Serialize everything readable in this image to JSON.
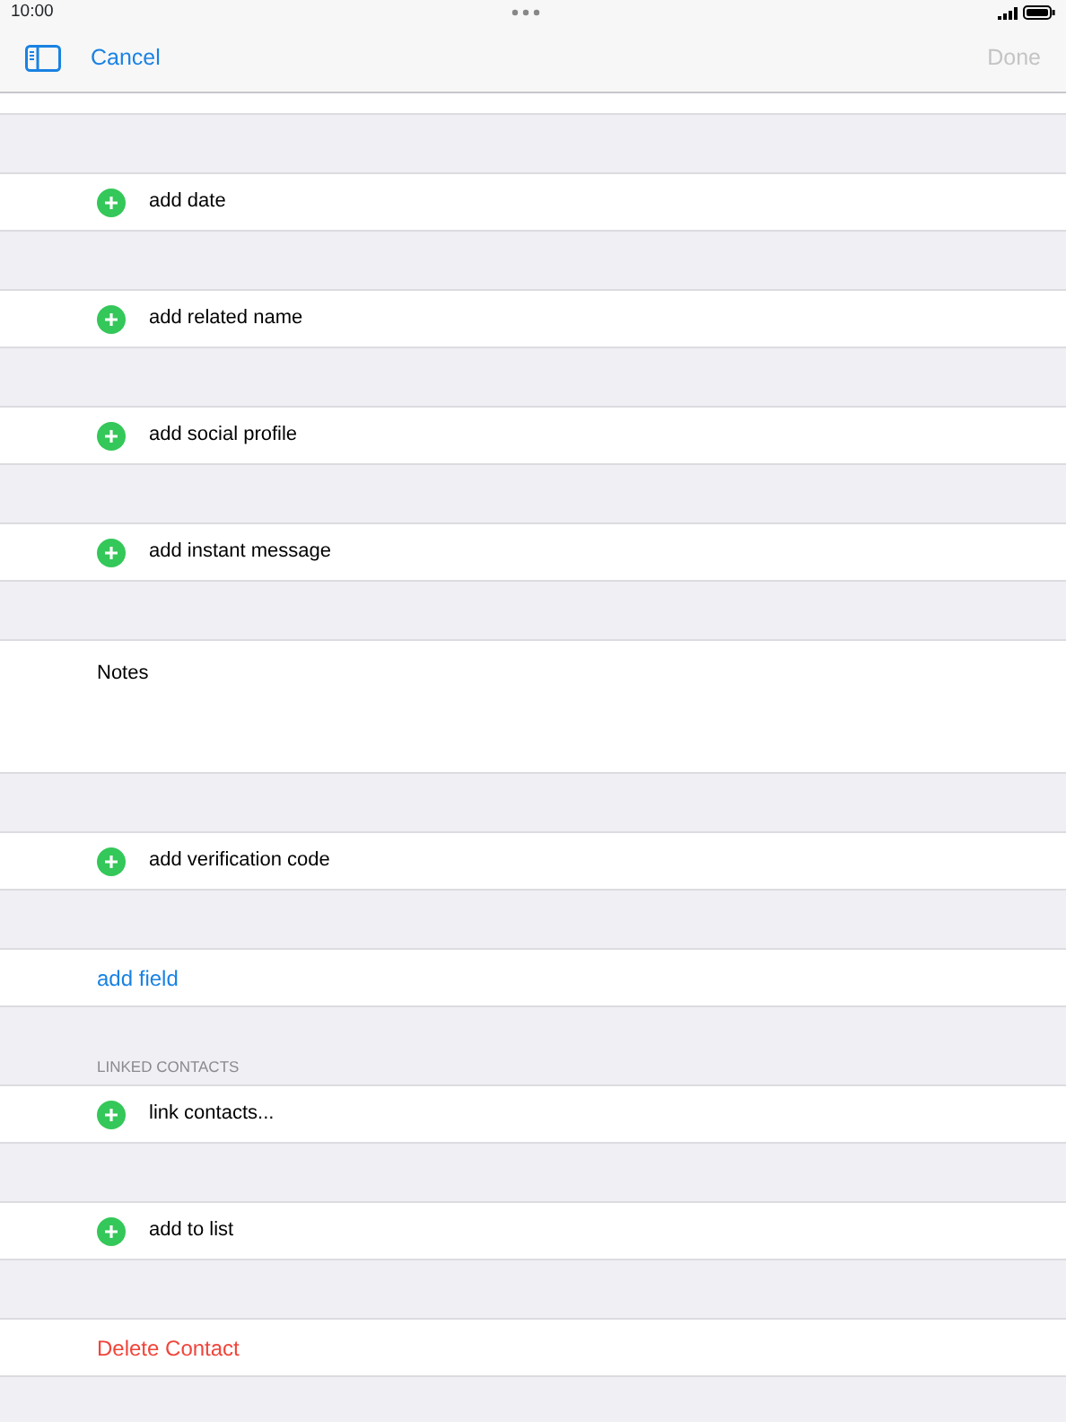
{
  "status_bar": {
    "time": "10:00"
  },
  "nav": {
    "cancel": "Cancel",
    "done": {
      "label": "Done",
      "disabled": true
    }
  },
  "sections": [
    {
      "rows": [
        {
          "kind": "add",
          "label": "add date"
        }
      ]
    },
    {
      "rows": [
        {
          "kind": "add",
          "label": "add related name"
        }
      ]
    },
    {
      "rows": [
        {
          "kind": "add",
          "label": "add social profile"
        }
      ]
    },
    {
      "rows": [
        {
          "kind": "add",
          "label": "add instant message"
        }
      ]
    },
    {
      "rows": [
        {
          "kind": "notes",
          "label": "Notes"
        }
      ]
    },
    {
      "rows": [
        {
          "kind": "add",
          "label": "add verification code"
        }
      ]
    },
    {
      "rows": [
        {
          "kind": "link",
          "label": "add field"
        }
      ]
    },
    {
      "header": "LINKED CONTACTS",
      "rows": [
        {
          "kind": "add",
          "label": "link contacts..."
        }
      ]
    },
    {
      "rows": [
        {
          "kind": "add",
          "label": "add to list"
        }
      ]
    },
    {
      "rows": [
        {
          "kind": "destructive",
          "label": "Delete Contact"
        }
      ]
    }
  ]
}
